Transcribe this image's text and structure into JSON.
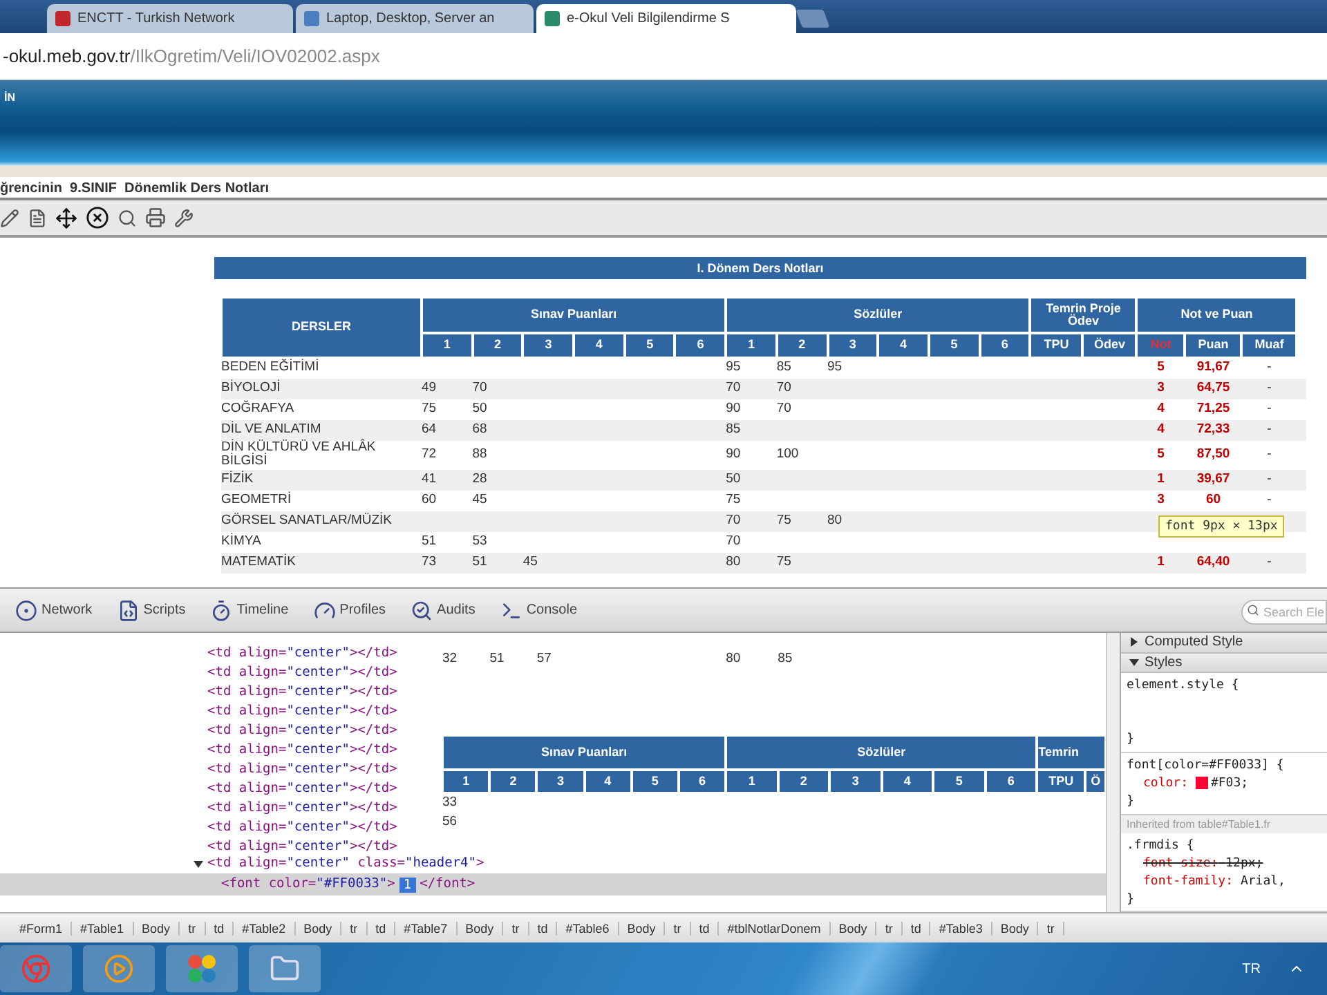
{
  "browser": {
    "tabs": [
      {
        "label": "ENCTT - Turkish Network",
        "selected": false
      },
      {
        "label": "Laptop, Desktop, Server an",
        "selected": false
      },
      {
        "label": "e-Okul Veli Bilgilendirme S",
        "selected": true
      }
    ],
    "address": {
      "host": "-okul.meb.gov.tr",
      "path": "/IlkOgretim/Veli/IOV02002.aspx"
    }
  },
  "banner": {
    "text": "İN"
  },
  "page_title": "ğrencinin  9.SINIF  Dönemlik Ders Notları",
  "grades": {
    "title": "I. Dönem Ders Notları",
    "headers": {
      "lessons": "DERSLER",
      "exams": "Sınav Puanları",
      "orals": "Sözlüler",
      "project": "Temrin Proje Ödev",
      "result": "Not ve Puan"
    },
    "exam_numbers": [
      "1",
      "2",
      "3",
      "4",
      "5",
      "6"
    ],
    "oral_numbers": [
      "1",
      "2",
      "3",
      "4",
      "5",
      "6"
    ],
    "project_cols": [
      "TPU",
      "Ödev"
    ],
    "result_cols": [
      "Not",
      "Puan",
      "Muaf"
    ],
    "rows": [
      {
        "lesson": "BEDEN EĞİTİMİ",
        "exams": [],
        "orals": [
          "95",
          "85",
          "95"
        ],
        "note": "5",
        "score": "91,67",
        "exempt": "-"
      },
      {
        "lesson": "BİYOLOJİ",
        "exams": [
          "49",
          "70"
        ],
        "orals": [
          "70",
          "70"
        ],
        "note": "3",
        "score": "64,75",
        "exempt": "-"
      },
      {
        "lesson": "COĞRAFYA",
        "exams": [
          "75",
          "50"
        ],
        "orals": [
          "90",
          "70"
        ],
        "note": "4",
        "score": "71,25",
        "exempt": "-"
      },
      {
        "lesson": "DİL VE ANLATIM",
        "exams": [
          "64",
          "68"
        ],
        "orals": [
          "85"
        ],
        "note": "4",
        "score": "72,33",
        "exempt": "-"
      },
      {
        "lesson": "DİN KÜLTÜRÜ VE AHLÂK BİLGİSİ",
        "exams": [
          "72",
          "88"
        ],
        "orals": [
          "90",
          "100"
        ],
        "note": "5",
        "score": "87,50",
        "exempt": "-"
      },
      {
        "lesson": "FİZİK",
        "exams": [
          "41",
          "28"
        ],
        "orals": [
          "50"
        ],
        "note": "1",
        "score": "39,67",
        "exempt": "-"
      },
      {
        "lesson": "GEOMETRİ",
        "exams": [
          "60",
          "45"
        ],
        "orals": [
          "75"
        ],
        "note": "3",
        "score": "60",
        "exempt": "-"
      },
      {
        "lesson": "GÖRSEL SANATLAR/MÜZİK",
        "exams": [],
        "orals": [
          "70",
          "75",
          "80"
        ]
      },
      {
        "lesson": "KİMYA",
        "exams": [
          "51",
          "53"
        ],
        "orals": [
          "70"
        ]
      },
      {
        "lesson": "MATEMATİK",
        "exams": [
          "73",
          "51",
          "45"
        ],
        "orals": [
          "80",
          "75"
        ],
        "note": "1",
        "score": "64,40",
        "exempt": "-"
      }
    ],
    "tooltip": "font 9px × 13px"
  },
  "devtools": {
    "panels": [
      {
        "label": "Network",
        "selected": false
      },
      {
        "label": "Scripts",
        "selected": false
      },
      {
        "label": "Timeline",
        "selected": false
      },
      {
        "label": "Profiles",
        "selected": false
      },
      {
        "label": "Audits",
        "selected": false
      },
      {
        "label": "Console",
        "selected": false
      }
    ],
    "search": {
      "placeholder": "Search Ele"
    },
    "code_lines": [
      "<td align=\"center\"></td>",
      "<td align=\"center\"></td>",
      "<td align=\"center\"></td>",
      "<td align=\"center\"></td>",
      "<td align=\"center\"></td>",
      "<td align=\"center\"></td>",
      "<td align=\"center\"></td>",
      "<td align=\"center\"></td>",
      "<td align=\"center\"></td>",
      "<td align=\"center\"></td>",
      "<td align=\"center\"></td>"
    ],
    "expanded_line": {
      "text": "<td align=\"center\" class=\"header4\">",
      "expanded": true
    },
    "selected_node": {
      "open": "<font color=\"#FF0033\">",
      "text": "1",
      "close": "</font>"
    },
    "preview": {
      "top_exams": [
        "32",
        "51",
        "57"
      ],
      "top_orals": [
        "80",
        "85"
      ],
      "exams_header": "Sınav Puanları",
      "orals_header": "Sözlüler",
      "project_header": "Temrin",
      "exam_numbers": [
        "1",
        "2",
        "3",
        "4",
        "5",
        "6"
      ],
      "oral_numbers": [
        "1",
        "2",
        "3",
        "4",
        "5",
        "6"
      ],
      "project_cols": [
        "TPU",
        "Ö"
      ],
      "rows": [
        "33",
        "56"
      ]
    },
    "sidebar": {
      "sections": [
        {
          "label": "Computed Style",
          "expanded": false
        },
        {
          "label": "Styles",
          "expanded": true
        }
      ],
      "rules": [
        {
          "selector": "element.style {",
          "end": "}"
        },
        {
          "selector": "font[color=#FF0033] {",
          "props": [
            {
              "name": "color:",
              "value": "#F03;",
              "color": "#ff0033",
              "struck": false
            }
          ],
          "end": "}"
        },
        {
          "inherited": "Inherited from table#Table1.fr",
          "selector": ".frmdis {",
          "props": [
            {
              "name": "font-size:",
              "value": "12px;",
              "struck": true
            },
            {
              "name": "font-family:",
              "value": "Arial,",
              "struck": false
            }
          ],
          "end": "}"
        }
      ]
    },
    "breadcrumbs": [
      "#Form1",
      "#Table1",
      "Body",
      "tr",
      "td",
      "#Table2",
      "Body",
      "tr",
      "td",
      "#Table7",
      "Body",
      "tr",
      "td",
      "#Table6",
      "Body",
      "tr",
      "td",
      "#tblNotlarDonem",
      "Body",
      "tr",
      "td",
      "#Table3",
      "Body",
      "tr"
    ]
  },
  "taskbar": {
    "language": "TR"
  }
}
